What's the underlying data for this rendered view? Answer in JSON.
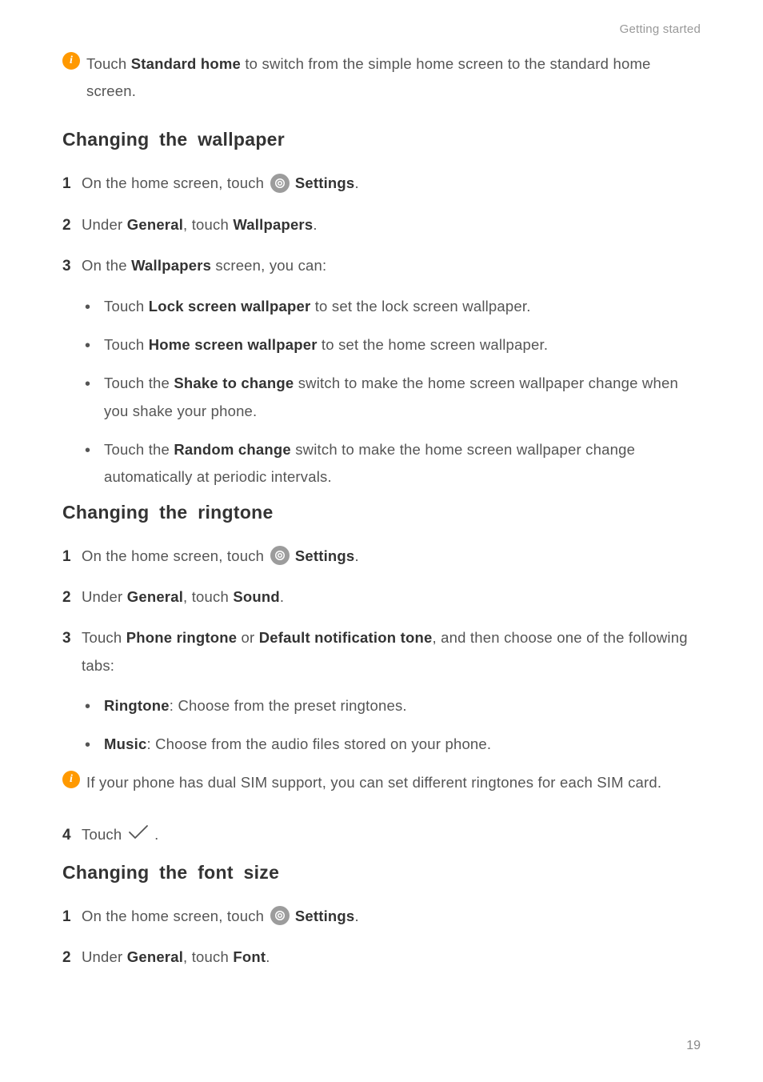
{
  "header": "Getting started",
  "note1_pre": "Touch ",
  "note1_bold": "Standard home",
  "note1_post": " to switch from the simple home screen to the standard home screen.",
  "section1_title": "Changing  the  wallpaper",
  "s1_step1_pre": "On the home screen, touch ",
  "s1_step1_bold": "Settings",
  "s1_step1_post": ".",
  "s1_step2_pre": "Under ",
  "s1_step2_b1": "General",
  "s1_step2_mid": ", touch ",
  "s1_step2_b2": "Wallpapers",
  "s1_step2_post": ".",
  "s1_step3_pre": "On the ",
  "s1_step3_bold": "Wallpapers",
  "s1_step3_post": " screen, you can:",
  "s1_b1_pre": "Touch ",
  "s1_b1_bold": "Lock screen wallpaper",
  "s1_b1_post": " to set the lock screen wallpaper.",
  "s1_b2_pre": "Touch ",
  "s1_b2_bold": "Home screen wallpaper",
  "s1_b2_post": " to set the home screen wallpaper.",
  "s1_b3_pre": "Touch the ",
  "s1_b3_bold": "Shake to change",
  "s1_b3_post": " switch to make the home screen wallpaper change when you shake your phone.",
  "s1_b4_pre": "Touch the ",
  "s1_b4_bold": "Random change",
  "s1_b4_post": " switch to make the home screen wallpaper change automatically at periodic intervals.",
  "section2_title": "Changing  the  ringtone",
  "s2_step1_pre": "On the home screen, touch ",
  "s2_step1_bold": "Settings",
  "s2_step1_post": ".",
  "s2_step2_pre": "Under ",
  "s2_step2_b1": "General",
  "s2_step2_mid": ", touch ",
  "s2_step2_b2": "Sound",
  "s2_step2_post": ".",
  "s2_step3_pre": "Touch ",
  "s2_step3_b1": "Phone ringtone",
  "s2_step3_mid": " or ",
  "s2_step3_b2": "Default notification tone",
  "s2_step3_post": ", and then choose one of the following tabs:",
  "s2_b1_bold": "Ringtone",
  "s2_b1_post": ": Choose from the preset ringtones.",
  "s2_b2_bold": "Music",
  "s2_b2_post": ": Choose from the audio files stored on your phone.",
  "note2": "If your phone has dual SIM support, you can set different ringtones for each SIM card.",
  "s2_step4_pre": "Touch ",
  "s2_step4_post": ".",
  "section3_title": "Changing  the  font  size",
  "s3_step1_pre": "On the home screen, touch ",
  "s3_step1_bold": "Settings",
  "s3_step1_post": ".",
  "s3_step2_pre": "Under ",
  "s3_step2_b1": "General",
  "s3_step2_mid": ", touch ",
  "s3_step2_b2": "Font",
  "s3_step2_post": ".",
  "page_number": "19"
}
